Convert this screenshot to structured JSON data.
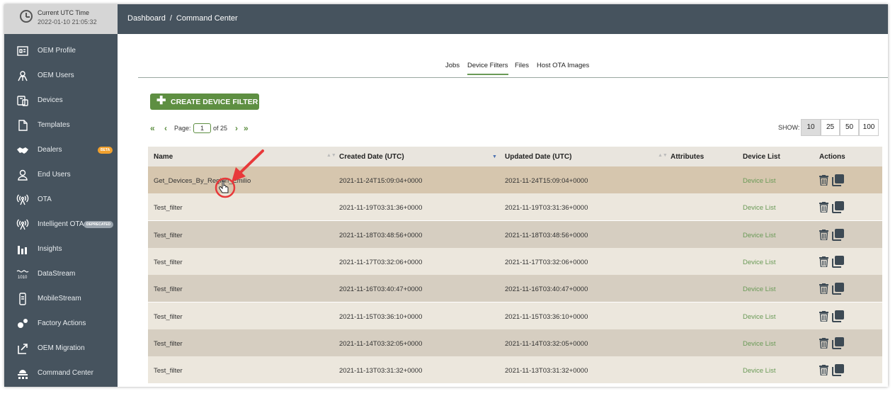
{
  "utc": {
    "label": "Current UTC Time",
    "time": "2022-01-10 21:05:32"
  },
  "breadcrumb": {
    "root": "Dashboard",
    "separator": "/",
    "current": "Command Center"
  },
  "sidebar": {
    "items": [
      {
        "label": "OEM Profile",
        "icon": "oem-profile-icon"
      },
      {
        "label": "OEM Users",
        "icon": "oem-users-icon"
      },
      {
        "label": "Devices",
        "icon": "devices-icon"
      },
      {
        "label": "Templates",
        "icon": "templates-icon"
      },
      {
        "label": "Dealers",
        "icon": "dealers-icon",
        "badge": "BETA"
      },
      {
        "label": "End Users",
        "icon": "end-users-icon"
      },
      {
        "label": "OTA",
        "icon": "ota-icon"
      },
      {
        "label": "Intelligent OTA",
        "icon": "intelligent-ota-icon",
        "badge": "DEPRECATED"
      },
      {
        "label": "Insights",
        "icon": "insights-icon"
      },
      {
        "label": "DataStream",
        "icon": "datastream-icon"
      },
      {
        "label": "MobileStream",
        "icon": "mobilestream-icon"
      },
      {
        "label": "Factory Actions",
        "icon": "factory-actions-icon"
      },
      {
        "label": "OEM Migration",
        "icon": "oem-migration-icon"
      },
      {
        "label": "Command Center",
        "icon": "command-center-icon"
      }
    ]
  },
  "tabs": [
    {
      "label": "Jobs",
      "active": false
    },
    {
      "label": "Device Filters",
      "active": true
    },
    {
      "label": "Files",
      "active": false
    },
    {
      "label": "Host OTA Images",
      "active": false
    }
  ],
  "create_button": {
    "label": "CREATE DEVICE FILTER"
  },
  "pager": {
    "page_label": "Page:",
    "page": "1",
    "of": "of 25"
  },
  "show": {
    "label": "SHOW:",
    "options": [
      "10",
      "25",
      "50",
      "100"
    ],
    "selected": "10"
  },
  "table": {
    "columns": [
      "Name",
      "Created Date (UTC)",
      "Updated Date (UTC)",
      "Attributes",
      "Device List",
      "Actions"
    ],
    "rows": [
      {
        "name": "Get_Devices_By_Region_Emilio",
        "created": "2021-11-24T15:09:04+0000",
        "updated": "2021-11-24T15:09:04+0000",
        "attributes": "",
        "device_list": "Device List"
      },
      {
        "name": "Test_filter",
        "created": "2021-11-19T03:31:36+0000",
        "updated": "2021-11-19T03:31:36+0000",
        "attributes": "",
        "device_list": "Device List"
      },
      {
        "name": "Test_filter",
        "created": "2021-11-18T03:48:56+0000",
        "updated": "2021-11-18T03:48:56+0000",
        "attributes": "",
        "device_list": "Device List"
      },
      {
        "name": "Test_filter",
        "created": "2021-11-17T03:32:06+0000",
        "updated": "2021-11-17T03:32:06+0000",
        "attributes": "",
        "device_list": "Device List"
      },
      {
        "name": "Test_filter",
        "created": "2021-11-16T03:40:47+0000",
        "updated": "2021-11-16T03:40:47+0000",
        "attributes": "",
        "device_list": "Device List"
      },
      {
        "name": "Test_filter",
        "created": "2021-11-15T03:36:10+0000",
        "updated": "2021-11-15T03:36:10+0000",
        "attributes": "",
        "device_list": "Device List"
      },
      {
        "name": "Test_filter",
        "created": "2021-11-14T03:32:05+0000",
        "updated": "2021-11-14T03:32:05+0000",
        "attributes": "",
        "device_list": "Device List"
      },
      {
        "name": "Test_filter",
        "created": "2021-11-13T03:31:32+0000",
        "updated": "2021-11-13T03:31:32+0000",
        "attributes": "",
        "device_list": "Device List"
      }
    ]
  },
  "colors": {
    "sidebar": "#46535e",
    "accent": "#5e8f42",
    "highlight_row": "#d6c6ae",
    "annotation": "#e8393a"
  }
}
